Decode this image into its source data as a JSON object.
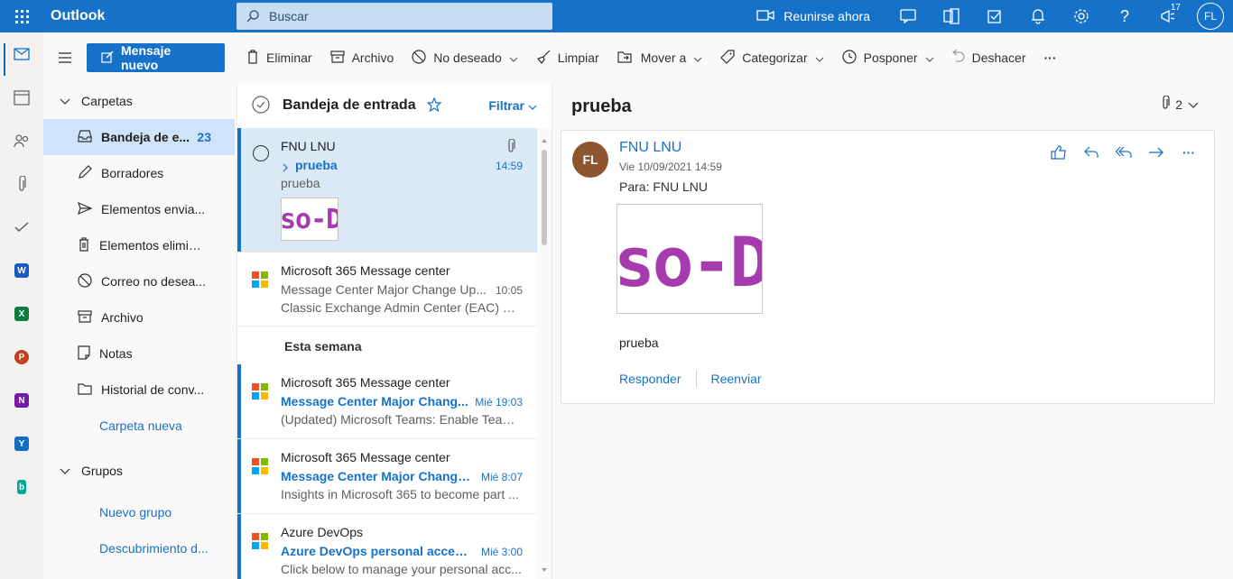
{
  "topbar": {
    "app_name": "Outlook",
    "search_placeholder": "Buscar",
    "meet_label": "Reunirse ahora",
    "notification_count": "17",
    "user_initials": "FL"
  },
  "toolbar": {
    "new_message": "Mensaje nuevo",
    "delete": "Eliminar",
    "archive": "Archivo",
    "junk": "No deseado",
    "sweep": "Limpiar",
    "move_to": "Mover a",
    "categorize": "Categorizar",
    "snooze": "Posponer",
    "undo": "Deshacer",
    "more": "···"
  },
  "folders": {
    "section_title": "Carpetas",
    "items": [
      {
        "label": "Bandeja de e...",
        "count": "23"
      },
      {
        "label": "Borradores"
      },
      {
        "label": "Elementos envia..."
      },
      {
        "label": "Elementos elimin..."
      },
      {
        "label": "Correo no desea..."
      },
      {
        "label": "Archivo"
      },
      {
        "label": "Notas"
      },
      {
        "label": "Historial de conv..."
      }
    ],
    "new_folder": "Carpeta nueva",
    "groups_title": "Grupos",
    "new_group": "Nuevo grupo",
    "discover": "Descubrimiento d..."
  },
  "list": {
    "title": "Bandeja de entrada",
    "filter": "Filtrar",
    "group_this_week": "Esta semana",
    "messages": [
      {
        "from": "FNU LNU",
        "subject": "prueba",
        "preview": "prueba",
        "time": "14:59",
        "thumb": "so-D"
      },
      {
        "from": "Microsoft 365 Message center",
        "subject": "Message Center Major Change Up...",
        "preview": "Classic Exchange Admin Center (EAC) Reti...",
        "time": "10:05"
      },
      {
        "from": "Microsoft 365 Message center",
        "subject": "Message Center Major Chang...",
        "preview": "(Updated) Microsoft Teams: Enable Teams...",
        "time": "Mié 19:03"
      },
      {
        "from": "Microsoft 365 Message center",
        "subject": "Message Center Major Change...",
        "preview": "Insights in Microsoft 365 to become part ...",
        "time": "Mié 8:07"
      },
      {
        "from": "Azure DevOps",
        "subject": "Azure DevOps personal access...",
        "preview": "Click below to manage your personal acc...",
        "time": "Mié 3:00"
      }
    ]
  },
  "reading": {
    "subject": "prueba",
    "attachment_count": "2",
    "sender_initials": "FL",
    "sender_name": "FNU LNU",
    "date": "Vie 10/09/2021 14:59",
    "to": "Para:  FNU LNU",
    "image_text": "so-D",
    "body": "prueba",
    "reply": "Responder",
    "forward": "Reenviar"
  },
  "colors": {
    "brand_blue": "#1672c8",
    "selected_folder": "#cfe4fa",
    "selected_message": "#dbe9f7",
    "sender_avatar": "#8e562e",
    "thumb_text": "#a53bae"
  }
}
